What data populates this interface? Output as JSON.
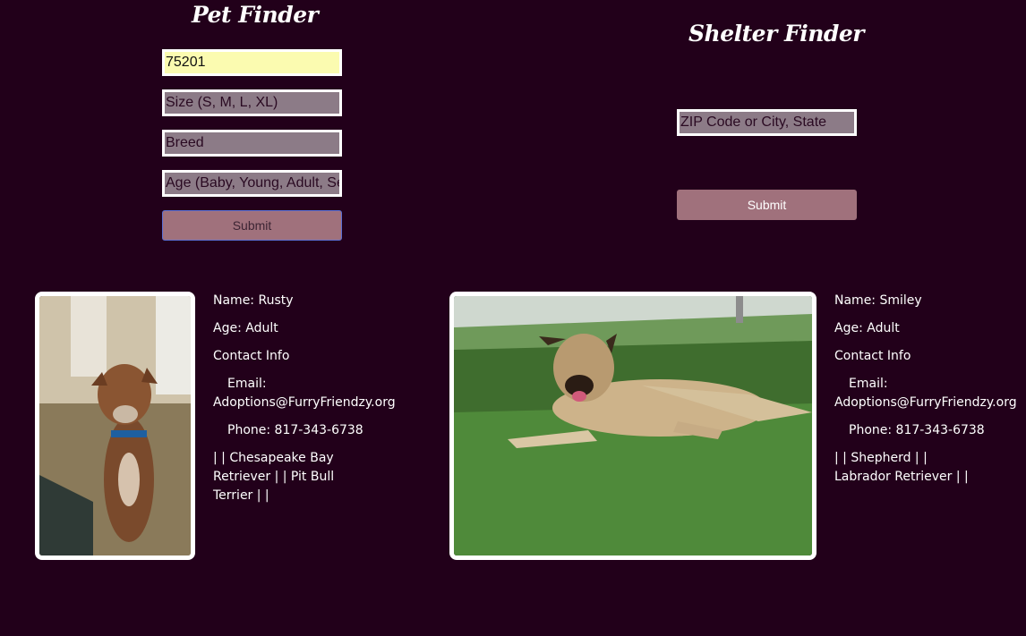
{
  "pet_finder": {
    "title": "Pet Finder",
    "location_value": "75201",
    "size_placeholder": "Size (S, M, L, XL)",
    "breed_placeholder": "Breed",
    "age_placeholder": "Age (Baby, Young, Adult, Senior)",
    "submit_label": "Submit"
  },
  "shelter_finder": {
    "title": "Shelter Finder",
    "location_placeholder": "ZIP Code or City, State",
    "submit_label": "Submit"
  },
  "pets": [
    {
      "name_line": "Name: Rusty",
      "age_line": "Age: Adult",
      "contact_heading": "Contact Info",
      "email_label": "Email:",
      "email": "Adoptions@FurryFriendzy.org",
      "phone_line": "Phone: 817-343-6738",
      "breeds": "| | Chesapeake Bay Retriever | | Pit Bull Terrier | |"
    },
    {
      "name_line": "Name: Smiley",
      "age_line": "Age: Adult",
      "contact_heading": "Contact Info",
      "email_label": "Email:",
      "email": "Adoptions@FurryFriendzy.org",
      "phone_line": "Phone: 817-343-6738",
      "breeds": "| | Shepherd | | Labrador Retriever | |"
    }
  ],
  "colors": {
    "background": "#22001a",
    "input_fill": "#8c7b87",
    "autofill_fill": "#fbfbb0",
    "button_fill": "#a0717c",
    "border": "#ffffff"
  }
}
